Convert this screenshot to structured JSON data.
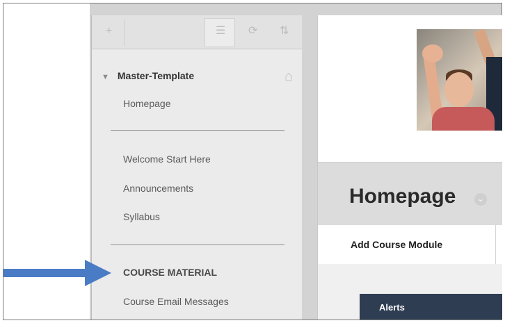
{
  "sidebar": {
    "course_title": "Master-Template",
    "items_top": [
      "Homepage"
    ],
    "items_mid": [
      "Welcome Start Here",
      "Announcements",
      "Syllabus"
    ],
    "section_label": "COURSE MATERIAL",
    "items_bottom": [
      "Course Email Messages"
    ]
  },
  "page": {
    "title": "Homepage"
  },
  "actions": {
    "add_module_label": "Add Course Module"
  },
  "modules": {
    "alerts_label": "Alerts"
  },
  "icons": {
    "toolbar": [
      "add-icon",
      "folder-view-icon",
      "refresh-icon",
      "sort-icon"
    ],
    "home": "home-icon",
    "annotation_arrow": "arrow-right-icon"
  },
  "colors": {
    "arrow": "#4a7cc5",
    "module_header": "#2f3d52"
  }
}
